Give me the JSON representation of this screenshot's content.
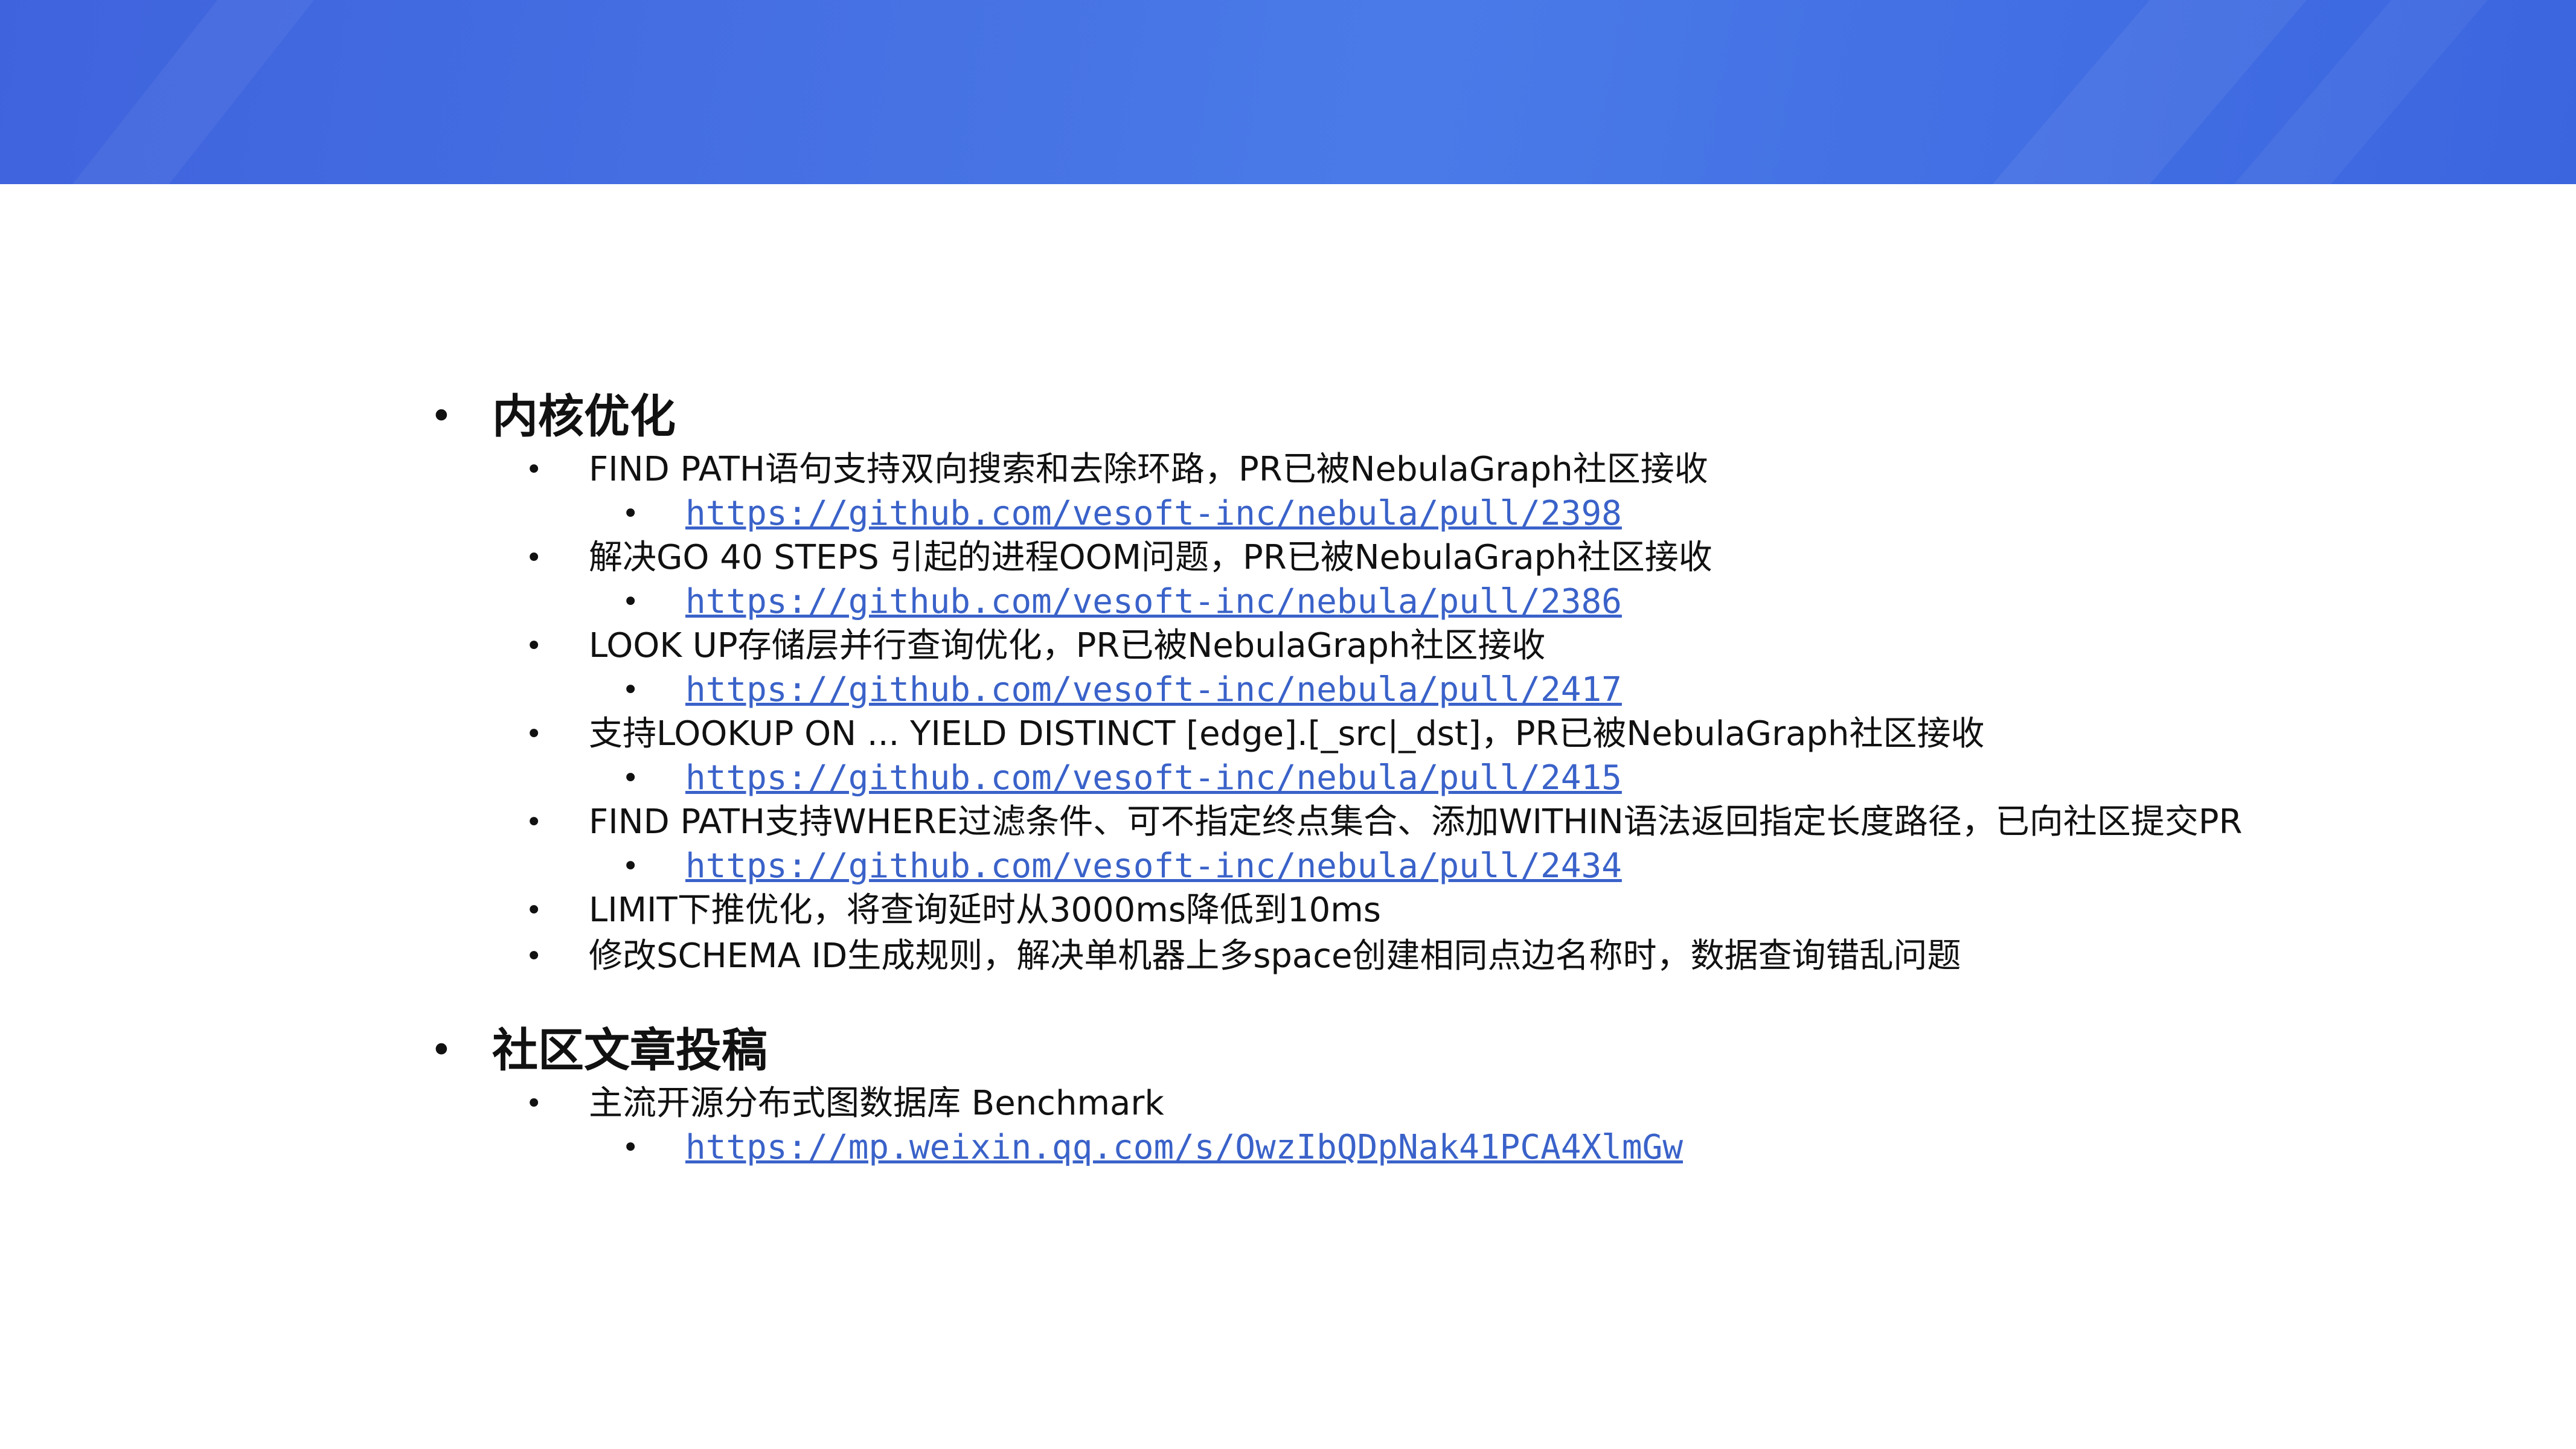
{
  "sections": [
    {
      "title": "内核优化",
      "items": [
        {
          "text": "FIND PATH语句支持双向搜索和去除环路，PR已被NebulaGraph社区接收",
          "link": "https://github.com/vesoft-inc/nebula/pull/2398"
        },
        {
          "text": "解决GO 40 STEPS 引起的进程OOM问题，PR已被NebulaGraph社区接收",
          "link": "https://github.com/vesoft-inc/nebula/pull/2386"
        },
        {
          "text": "LOOK UP存储层并行查询优化，PR已被NebulaGraph社区接收",
          "link": "https://github.com/vesoft-inc/nebula/pull/2417"
        },
        {
          "text": "支持LOOKUP ON ... YIELD DISTINCT [edge].[_src|_dst]，PR已被NebulaGraph社区接收",
          "link": "https://github.com/vesoft-inc/nebula/pull/2415"
        },
        {
          "text": "FIND PATH支持WHERE过滤条件、可不指定终点集合、添加WITHIN语法返回指定长度路径，已向社区提交PR",
          "link": "https://github.com/vesoft-inc/nebula/pull/2434"
        },
        {
          "text": "LIMIT下推优化，将查询延时从3000ms降低到10ms"
        },
        {
          "text": "修改SCHEMA ID生成规则，解决单机器上多space创建相同点边名称时，数据查询错乱问题"
        }
      ]
    },
    {
      "title": "社区文章投稿",
      "items": [
        {
          "text": "主流开源分布式图数据库 Benchmark",
          "link": "https://mp.weixin.qq.com/s/OwzIbQDpNak41PCA4XlmGw"
        }
      ]
    }
  ],
  "colors": {
    "banner": "#4270e3",
    "link": "#3a62c9"
  }
}
